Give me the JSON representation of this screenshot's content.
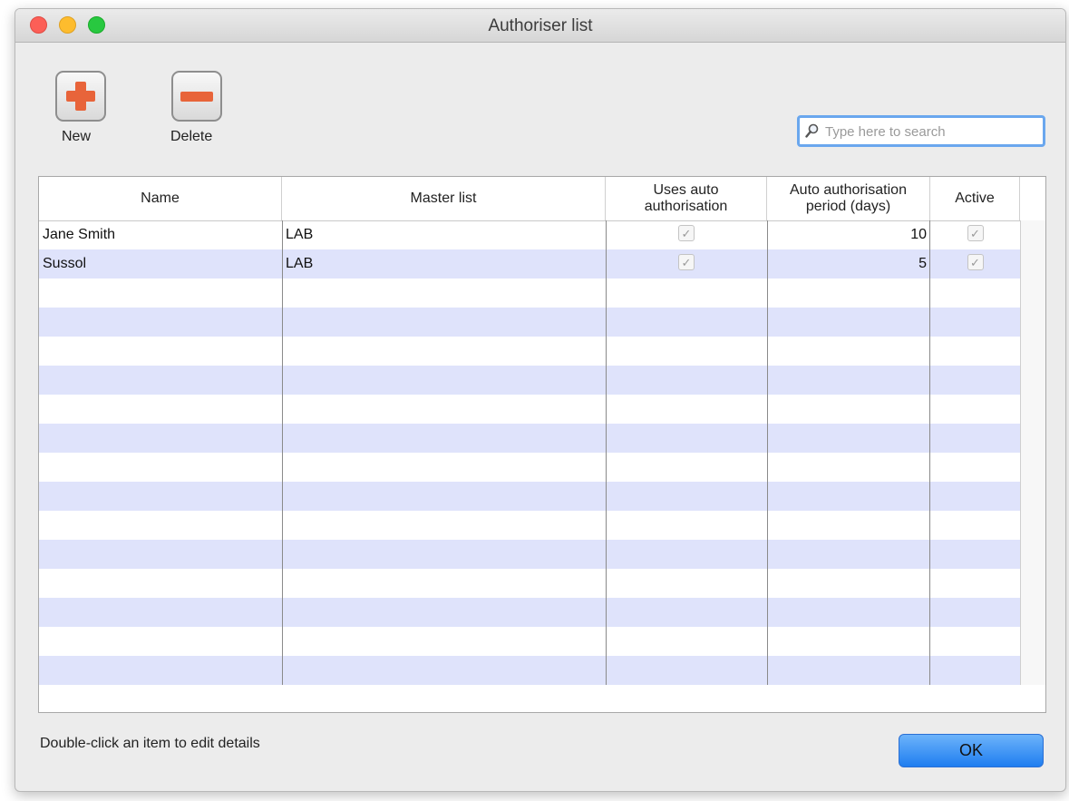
{
  "window": {
    "title": "Authoriser list"
  },
  "toolbar": {
    "new_label": "New",
    "delete_label": "Delete"
  },
  "search": {
    "placeholder": "Type here to search",
    "value": ""
  },
  "table": {
    "columns": [
      "Name",
      "Master list",
      "Uses auto authorisation",
      "Auto authorisation period (days)",
      "Active"
    ],
    "rows": [
      {
        "name": "Jane Smith",
        "master_list": "LAB",
        "uses_auto": true,
        "period": "10",
        "active": true
      },
      {
        "name": "Sussol",
        "master_list": "LAB",
        "uses_auto": true,
        "period": "5",
        "active": true
      }
    ]
  },
  "footer": {
    "hint": "Double-click an item to edit details",
    "ok_label": "OK"
  },
  "colors": {
    "row_stripe": "#dfe3fb",
    "ok_button": "#2b86f3",
    "icon_accent": "#e8643a"
  },
  "icons": {
    "new": "plus-icon",
    "delete": "minus-icon",
    "search": "magnifier-icon",
    "checkbox": "check-icon"
  }
}
